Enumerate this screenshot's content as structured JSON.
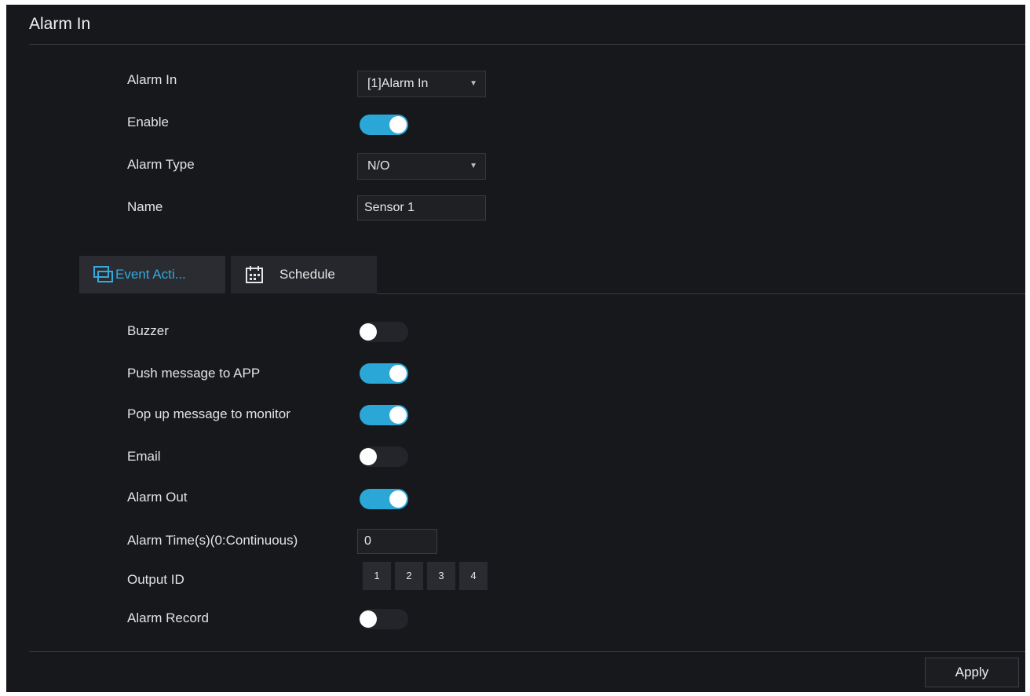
{
  "title": "Alarm In",
  "fields": {
    "alarm_in_label": "Alarm In",
    "alarm_in_value": "[1]Alarm In",
    "enable_label": "Enable",
    "enable_on": true,
    "alarm_type_label": "Alarm Type",
    "alarm_type_value": "N/O",
    "name_label": "Name",
    "name_value": "Sensor 1"
  },
  "tabs": [
    {
      "label": "Event Acti...",
      "active": true,
      "icon": "event-action-icon"
    },
    {
      "label": "Schedule",
      "active": false,
      "icon": "calendar-icon"
    }
  ],
  "actions": {
    "buzzer_label": "Buzzer",
    "buzzer_on": false,
    "push_label": "Push message to APP",
    "push_on": true,
    "popup_label": "Pop up message to monitor",
    "popup_on": true,
    "email_label": "Email",
    "email_on": false,
    "alarm_out_label": "Alarm Out",
    "alarm_out_on": true,
    "alarm_time_label": "Alarm Time(s)(0:Continuous)",
    "alarm_time_value": "0",
    "output_id_label": "Output ID",
    "output_ids": [
      "1",
      "2",
      "3",
      "4"
    ],
    "alarm_record_label": "Alarm Record",
    "alarm_record_on": false
  },
  "apply_label": "Apply",
  "colors": {
    "accent": "#2aa7d6",
    "background": "#17181c"
  }
}
